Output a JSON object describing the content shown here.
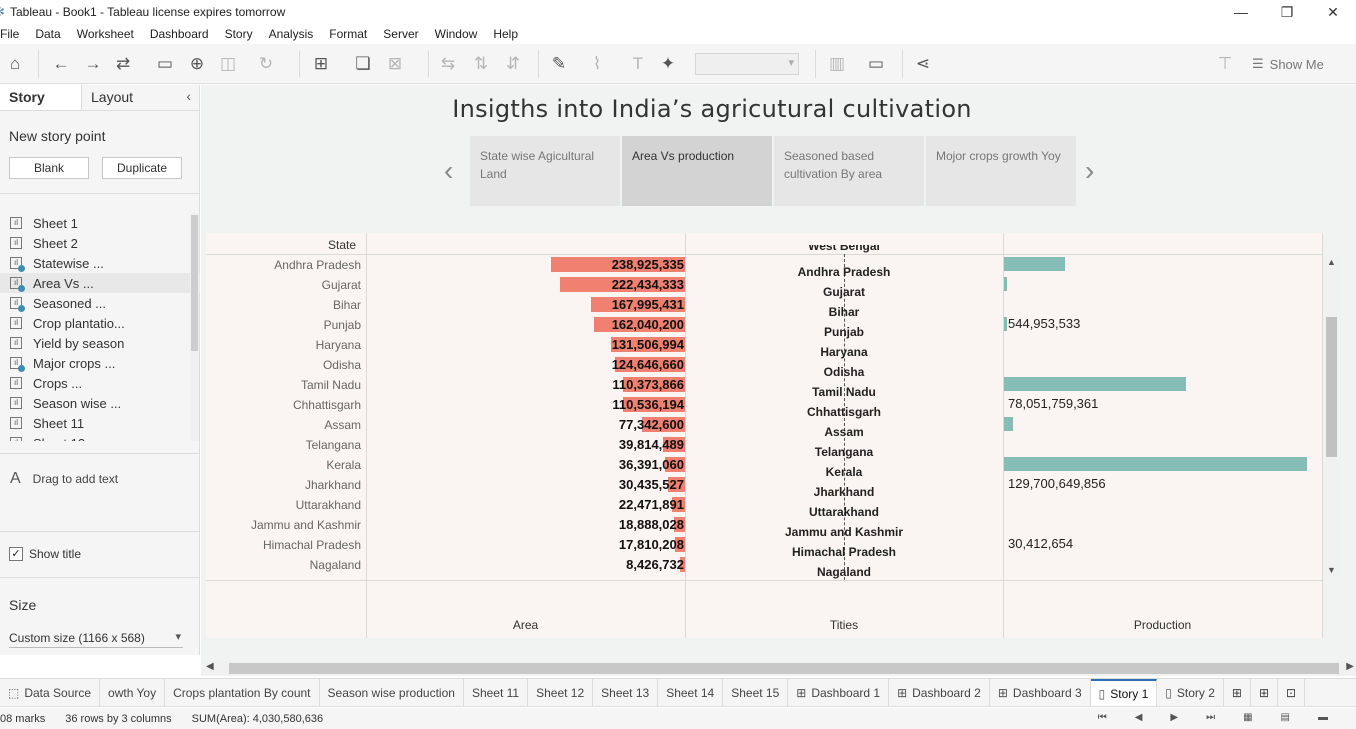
{
  "window": {
    "title": "Tableau - Book1 - Tableau license expires tomorrow",
    "controls": [
      "—",
      "❐",
      "✕"
    ]
  },
  "menu": [
    "File",
    "Data",
    "Worksheet",
    "Dashboard",
    "Story",
    "Analysis",
    "Format",
    "Server",
    "Window",
    "Help"
  ],
  "toolbar": {
    "show_me": "Show Me"
  },
  "sidebar": {
    "tabs": [
      "Story",
      "Layout"
    ],
    "new_story_point": "New story point",
    "blank": "Blank",
    "duplicate": "Duplicate",
    "sheets": [
      {
        "label": "Sheet 1",
        "used": false
      },
      {
        "label": "Sheet 2",
        "used": false
      },
      {
        "label": "Statewise ...",
        "used": true
      },
      {
        "label": "Area Vs ...",
        "used": true
      },
      {
        "label": "Seasoned ...",
        "used": true
      },
      {
        "label": "Crop plantatio...",
        "used": false
      },
      {
        "label": "Yield by season",
        "used": false
      },
      {
        "label": "Major crops ...",
        "used": true
      },
      {
        "label": "Crops ...",
        "used": false
      },
      {
        "label": "Season wise ...",
        "used": false
      },
      {
        "label": "Sheet 11",
        "used": false
      },
      {
        "label": "Sheet 12",
        "used": false
      }
    ],
    "drag_to_add_text": "Drag to add text",
    "show_title": "Show title",
    "size_heading": "Size",
    "size_value": "Custom size (1166 x 568)"
  },
  "story": {
    "title": "Insigths into India’s agricutural cultivation",
    "points": [
      "State wise Agicultural Land",
      "Area Vs production",
      "Seasoned based cultivation By area",
      "Mojor crops growth Yoy"
    ],
    "active_point": 1
  },
  "chart_data": {
    "type": "bar",
    "row_header": "State",
    "states": [
      "Andhra Pradesh",
      "Gujarat",
      "Bihar",
      "Punjab",
      "Haryana",
      "Odisha",
      "Tamil Nadu",
      "Chhattisgarh",
      "Assam",
      "Telangana",
      "Kerala",
      "Jharkhand",
      "Uttarakhand",
      "Jammu and Kashmir",
      "Himachal Pradesh",
      "Nagaland"
    ],
    "area_labels": [
      "238,925,335",
      "222,434,333",
      "167,995,431",
      "162,040,200",
      "131,506,994",
      "124,646,660",
      "110,373,866",
      "110,536,194",
      "77,342,600",
      "39,814,489",
      "36,391,060",
      "30,435,527",
      "22,471,891",
      "18,888,028",
      "17,810,208",
      "8,426,732"
    ],
    "area_values": [
      238925335,
      222434333,
      167995431,
      162040200,
      131506994,
      124646660,
      110373866,
      110536194,
      77342600,
      39814489,
      36391060,
      30435527,
      22471891,
      18888028,
      17810208,
      8426732
    ],
    "tities_column": [
      "West Bengal",
      "Andhra Pradesh",
      "Gujarat",
      "Bihar",
      "Punjab",
      "Haryana",
      "Odisha",
      "Tamil Nadu",
      "Chhattisgarh",
      "Assam",
      "Telangana",
      "Kerala",
      "Jharkhand",
      "Uttarakhand",
      "Jammu and Kashmir",
      "Himachal Pradesh",
      "Nagaland"
    ],
    "production_bars": [
      {
        "row": 0,
        "value": 0.2
      },
      {
        "row": 1,
        "value": 0.01
      },
      {
        "row": 3,
        "value": 0.01
      },
      {
        "row": 6,
        "value": 0.6
      },
      {
        "row": 8,
        "value": 0.03
      },
      {
        "row": 10,
        "value": 1.0
      }
    ],
    "production_labels": [
      {
        "row": 3,
        "text": "544,953,533"
      },
      {
        "row": 7,
        "text": "78,051,759,361"
      },
      {
        "row": 11,
        "text": "129,700,649,856"
      },
      {
        "row": 14,
        "text": "30,412,654"
      }
    ],
    "axis_labels": [
      "Area",
      "Tities",
      "Production"
    ]
  },
  "bottom_tabs": [
    {
      "label": "Data Source",
      "icon": "datasource-icon",
      "active": false
    },
    {
      "label": "owth Yoy",
      "icon": "",
      "active": false
    },
    {
      "label": "Crops plantation By count",
      "icon": "",
      "active": false
    },
    {
      "label": "Season wise production",
      "icon": "",
      "active": false
    },
    {
      "label": "Sheet 11",
      "icon": "",
      "active": false
    },
    {
      "label": "Sheet 12",
      "icon": "",
      "active": false
    },
    {
      "label": "Sheet 13",
      "icon": "",
      "active": false
    },
    {
      "label": "Sheet 14",
      "icon": "",
      "active": false
    },
    {
      "label": "Sheet 15",
      "icon": "",
      "active": false
    },
    {
      "label": "Dashboard 1",
      "icon": "dashboard-icon",
      "active": false
    },
    {
      "label": "Dashboard 2",
      "icon": "dashboard-icon",
      "active": false
    },
    {
      "label": "Dashboard 3",
      "icon": "dashboard-icon",
      "active": false
    },
    {
      "label": "Story 1",
      "icon": "story-icon",
      "active": true
    },
    {
      "label": "Story 2",
      "icon": "story-icon",
      "active": false
    }
  ],
  "status": {
    "marks": "08 marks",
    "rows_cols": "36 rows by 3 columns",
    "sum": "SUM(Area): 4,030,580,636"
  },
  "colors": {
    "area_bar": "#f08070",
    "production_bar": "#85bcb6",
    "active_tab_accent": "#2f6db0"
  }
}
